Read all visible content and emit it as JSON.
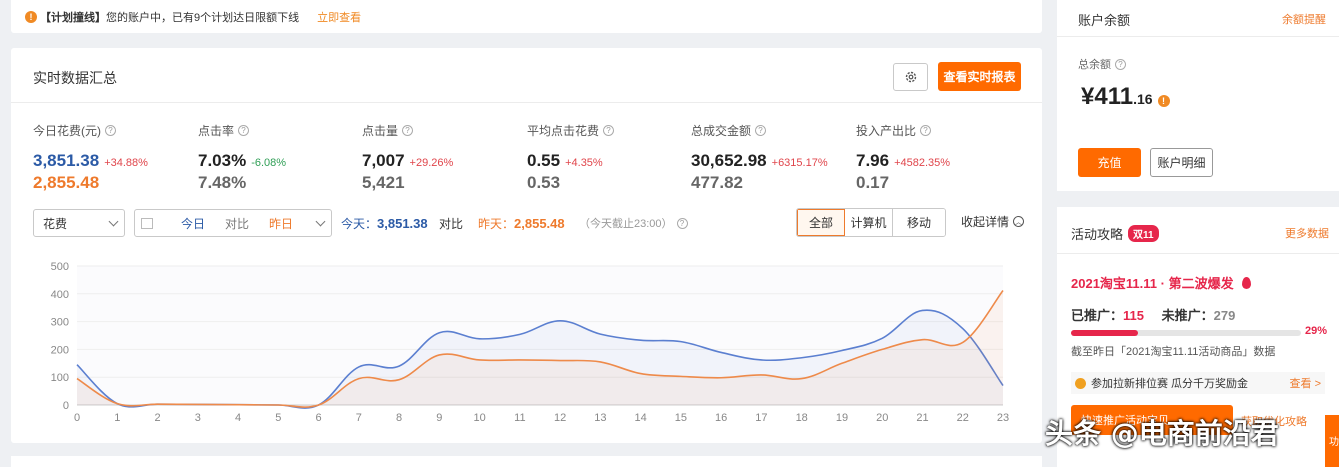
{
  "notice": {
    "tag": "【计划撞线】",
    "message": "您的账户中，已有9个计划达日限额下线",
    "link": "立即查看"
  },
  "summary": {
    "title": "实时数据汇总",
    "report_button": "查看实时报表",
    "metrics": [
      {
        "label": "今日花费(元)",
        "today": "3,851.38",
        "change": "+34.88%",
        "yesterday": "2,855.48"
      },
      {
        "label": "点击率",
        "today": "7.03%",
        "change": "-6.08%",
        "yesterday": "7.48%"
      },
      {
        "label": "点击量",
        "today": "7,007",
        "change": "+29.26%",
        "yesterday": "5,421"
      },
      {
        "label": "平均点击花费",
        "today": "0.55",
        "change": "+4.35%",
        "yesterday": "0.53"
      },
      {
        "label": "总成交金额",
        "today": "30,652.98",
        "change": "+6315.17%",
        "yesterday": "477.82"
      },
      {
        "label": "投入产出比",
        "today": "7.96",
        "change": "+4582.35%",
        "yesterday": "0.17"
      }
    ],
    "metric_select": "花费",
    "date_compare": {
      "today": "今日",
      "vs": "对比",
      "yesterday": "昨日"
    },
    "today_label": "今天：",
    "today_value": "3,851.38",
    "vs_label": "对比",
    "yesterday_label": "昨天：",
    "yesterday_value": "2,855.48",
    "cutoff": "（今天截止23:00）",
    "device_tabs": [
      "全部",
      "计算机",
      "移动"
    ],
    "collapse": "收起详情"
  },
  "chart_data": {
    "type": "area",
    "x": [
      0,
      1,
      2,
      3,
      4,
      5,
      6,
      7,
      8,
      9,
      10,
      11,
      12,
      13,
      14,
      15,
      16,
      17,
      18,
      19,
      20,
      21,
      22,
      23
    ],
    "ylim": [
      0,
      500
    ],
    "yticks": [
      0,
      100,
      200,
      300,
      400,
      500
    ],
    "series": [
      {
        "name": "今天",
        "color": "#5b7fd0",
        "values": [
          145,
          5,
          3,
          2,
          1,
          0,
          0,
          137,
          140,
          260,
          238,
          254,
          303,
          255,
          233,
          228,
          189,
          162,
          170,
          196,
          240,
          340,
          275,
          70
        ]
      },
      {
        "name": "昨天",
        "color": "#ee8a4a",
        "values": [
          95,
          5,
          3,
          2,
          1,
          0,
          0,
          95,
          91,
          180,
          162,
          162,
          160,
          155,
          113,
          103,
          98,
          108,
          95,
          150,
          200,
          235,
          225,
          412
        ]
      }
    ]
  },
  "balance": {
    "title": "账户余额",
    "reminder": "余额提醒",
    "total_label": "总余额",
    "currency": "¥",
    "integer": "411",
    "decimal": ".16",
    "recharge": "充值",
    "detail": "账户明细"
  },
  "activity": {
    "title": "活动攻略",
    "badge": "双11",
    "more": "更多数据",
    "event": "2021淘宝11.11 · 第二波爆发",
    "promoted_label": "已推广：",
    "promoted": "115",
    "unpromoted_label": "未推广：",
    "unpromoted": "279",
    "progress": 0.29,
    "progress_label": "29%",
    "note": "截至昨日「2021淘宝11.11活动商品」数据",
    "join_text": "参加拉新排位赛 瓜分千万奖励金",
    "join_more": "查看 >",
    "fast_button": "快速推广活动宝贝",
    "guide": "获取优化攻略",
    "side_tab": "功"
  },
  "watermark": "头条 @电商前沿君"
}
